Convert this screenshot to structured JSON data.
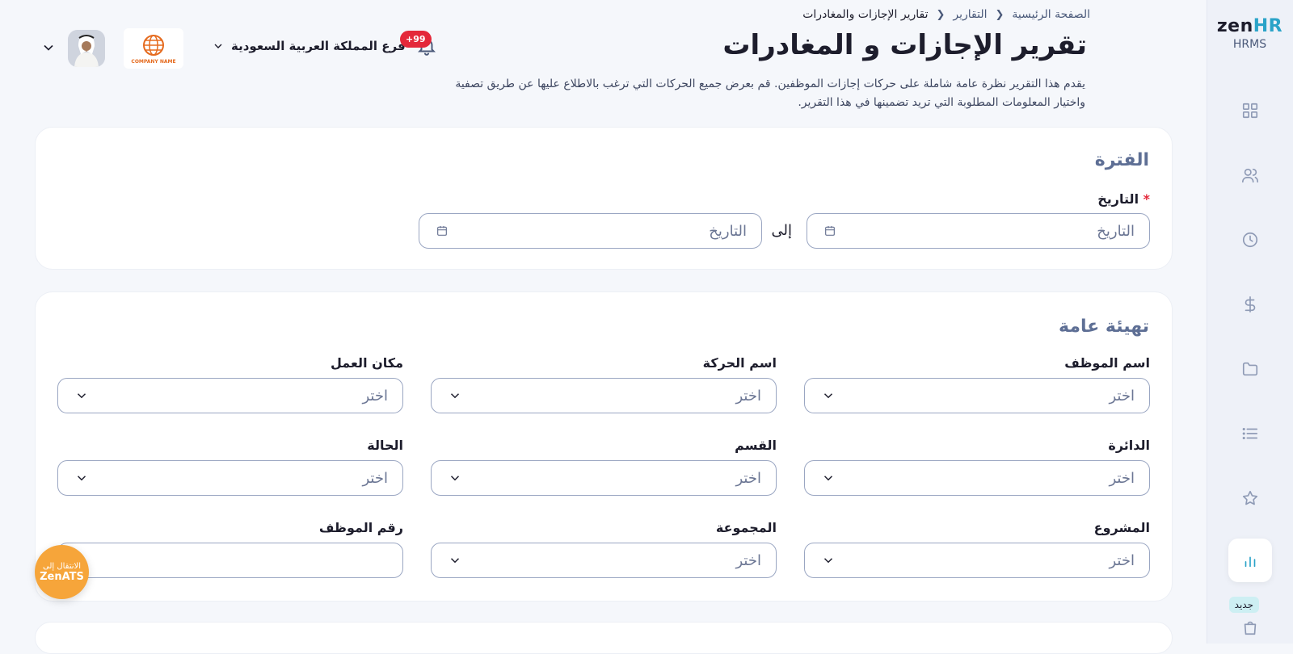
{
  "app": {
    "logo_zen": "zen",
    "logo_hr": "HR",
    "logo_sub": "HRMS",
    "new_badge": "جديد"
  },
  "sidebar": {
    "items": [
      {
        "icon": "grid-icon"
      },
      {
        "icon": "users-icon"
      },
      {
        "icon": "clock-icon"
      },
      {
        "icon": "dollar-icon"
      },
      {
        "icon": "folder-icon"
      },
      {
        "icon": "list-icon"
      },
      {
        "icon": "star-icon"
      },
      {
        "icon": "bar-chart-icon",
        "active": true
      },
      {
        "icon": "bag-icon"
      }
    ],
    "active_color": "#2aa3c8"
  },
  "breadcrumb": {
    "home": "الصفحة الرئيسية",
    "reports": "التقارير",
    "current": "تقارير الإجازات والمغادرات"
  },
  "page": {
    "title": "تقرير الإجازات و المغادرات",
    "description": "يقدم هذا التقرير نظرة عامة شاملة على حركات إجازات الموظفين. قم بعرض جميع الحركات التي ترغب بالاطلاع عليها عن طريق تصفية واختيار المعلومات المطلوبة التي تريد تضمينها في هذا التقرير."
  },
  "header": {
    "notifications_count": "+99",
    "branch": "فرع المملكة العربية السعودية",
    "company_name": "COMPANY NAME"
  },
  "period": {
    "heading": "الفترة",
    "date_label": "التاريخ",
    "required_mark": "*",
    "from_placeholder": "التاريخ",
    "to_label": "إلى",
    "to_placeholder": "التاريخ"
  },
  "general": {
    "heading": "تهيئة عامة",
    "placeholder": "اختر",
    "fields": {
      "employee_name": "اسم الموظف",
      "movement_name": "اسم الحركة",
      "work_location": "مكان العمل",
      "department": "الدائرة",
      "section": "القسم",
      "status": "الحالة",
      "project": "المشروع",
      "group": "المجموعة",
      "employee_number": "رقم الموظف"
    }
  },
  "ats_button": {
    "line1": "الانتقال إلى",
    "line2": "ZenATS",
    "color": "#f6a53a"
  }
}
